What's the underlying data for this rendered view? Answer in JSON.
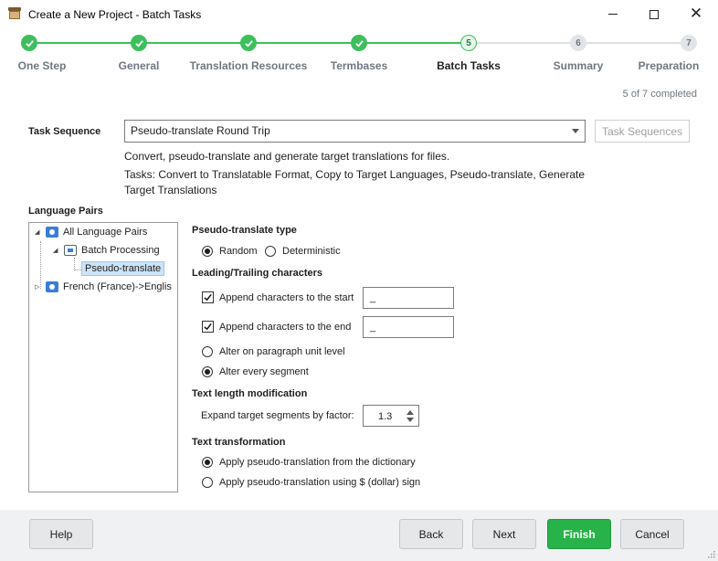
{
  "window": {
    "title": "Create a New Project - Batch Tasks"
  },
  "steps": [
    {
      "label": "One Step",
      "state": "done"
    },
    {
      "label": "General",
      "state": "done"
    },
    {
      "label": "Translation Resources",
      "state": "done"
    },
    {
      "label": "Termbases",
      "state": "done"
    },
    {
      "label": "Batch Tasks",
      "state": "current",
      "number": "5"
    },
    {
      "label": "Summary",
      "state": "todo",
      "number": "6"
    },
    {
      "label": "Preparation",
      "state": "todo",
      "number": "7"
    }
  ],
  "progress_text": "5 of 7 completed",
  "task_sequence": {
    "label": "Task Sequence",
    "selected": "Pseudo-translate Round Trip",
    "button_label": "Task Sequences",
    "description": "Convert, pseudo-translate and generate target translations for files.",
    "tasks_line1": "Tasks: Convert to Translatable Format, Copy to Target Languages, Pseudo-translate, Generate",
    "tasks_line2": "Target Translations"
  },
  "language_pairs": {
    "label": "Language Pairs",
    "items": {
      "all": "All Language Pairs",
      "batch": "Batch Processing",
      "pseudo": "Pseudo-translate",
      "french": "French (France)->Englis"
    }
  },
  "pseudo_type": {
    "heading": "Pseudo-translate type",
    "random": "Random",
    "deterministic": "Deterministic",
    "selected": "Random"
  },
  "leading_trailing": {
    "heading": "Leading/Trailing characters",
    "append_start_label": "Append characters to the start",
    "append_start_value": "_",
    "append_end_label": "Append characters to the end",
    "append_end_value": "_",
    "paragraph_level": "Alter on paragraph unit level",
    "every_segment": "Alter every segment",
    "selected": "every_segment"
  },
  "text_length": {
    "heading": "Text length modification",
    "expand_label": "Expand target segments by factor:",
    "factor": "1.3"
  },
  "text_transformation": {
    "heading": "Text transformation",
    "dictionary": "Apply pseudo-translation from the dictionary",
    "dollar": "Apply pseudo-translation using $ (dollar) sign",
    "selected": "dictionary"
  },
  "footer": {
    "help": "Help",
    "back": "Back",
    "next": "Next",
    "finish": "Finish",
    "cancel": "Cancel"
  },
  "colors": {
    "accent": "#3dbf5d",
    "finish": "#27b24a"
  }
}
